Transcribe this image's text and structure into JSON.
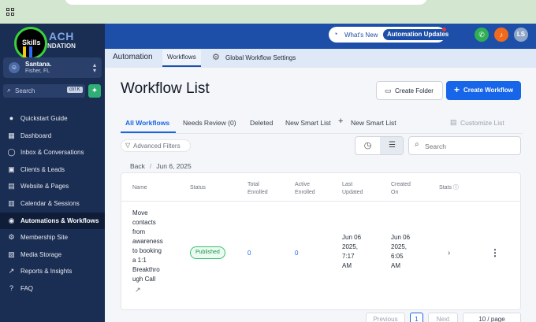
{
  "sidebar": {
    "logo_badge": "Skills",
    "logo_title": "ACH",
    "logo_subtitle": "NDATION",
    "account": {
      "initial": "☺",
      "name": "Santana.",
      "location": "Fisher, FL"
    },
    "search": {
      "placeholder": "Search",
      "shortcut": "ctrl K"
    },
    "items": [
      {
        "label": "Quickstart Guide",
        "icon": "quickstart-icon"
      },
      {
        "label": "Dashboard",
        "icon": "dashboard-icon"
      },
      {
        "label": "Inbox & Conversations",
        "icon": "chat-icon"
      },
      {
        "label": "Clients & Leads",
        "icon": "contacts-icon"
      },
      {
        "label": "Website & Pages",
        "icon": "website-icon"
      },
      {
        "label": "Calendar & Sessions",
        "icon": "calendar-icon"
      },
      {
        "label": "Automations & Workflows",
        "icon": "automation-icon",
        "active": true
      },
      {
        "label": "Membership Site",
        "icon": "membership-icon"
      },
      {
        "label": "Media Storage",
        "icon": "media-icon"
      },
      {
        "label": "Reports & Insights",
        "icon": "reports-icon"
      },
      {
        "label": "FAQ",
        "icon": "faq-icon"
      }
    ]
  },
  "header": {
    "whats_new": "What's New",
    "automation_updates": "Automation Updates",
    "user_initials": "LS"
  },
  "subnav": {
    "title": "Automation",
    "tab_workflows": "Workflows",
    "global_settings": "Global Workflow Settings"
  },
  "main": {
    "title": "Workflow List",
    "create_folder": "Create Folder",
    "create_workflow": "Create Workflow",
    "tabs": {
      "all": "All Workflows",
      "review": "Needs Review (0)",
      "deleted": "Deleted",
      "smart": "New Smart List",
      "new_smart": "New Smart List",
      "customize": "Customize List"
    },
    "advanced_filters": "Advanced Filters",
    "search_placeholder": "Search",
    "breadcrumb": {
      "back": "Back",
      "separator": "/",
      "folder": "Jun 6, 2025"
    },
    "table": {
      "headers": {
        "name": "Name",
        "status": "Status",
        "total_1": "Total",
        "total_2": "Enrolled",
        "active_1": "Active",
        "active_2": "Enrolled",
        "last_1": "Last",
        "last_2": "Updated",
        "created_1": "Created",
        "created_2": "On",
        "stats": "Stats"
      },
      "row": {
        "name_lines": [
          "Move",
          "contacts",
          "from",
          "awareness",
          "to booking",
          "a 1:1",
          "Breakthro",
          "ugh Call"
        ],
        "status": "Published",
        "total": "0",
        "active": "0",
        "updated_lines": [
          "Jun 06",
          "2025,",
          "7:17",
          "AM"
        ],
        "created_lines": [
          "Jun 06",
          "2025,",
          "6:05",
          "AM"
        ]
      }
    },
    "pagination": {
      "previous": "Previous",
      "page": "1",
      "next": "Next",
      "per_page": "10 / page"
    }
  },
  "colors": {
    "sidebar": "#1a2d52",
    "header": "#1e4fa8",
    "primary": "#1765e8",
    "published": "#17924b"
  }
}
